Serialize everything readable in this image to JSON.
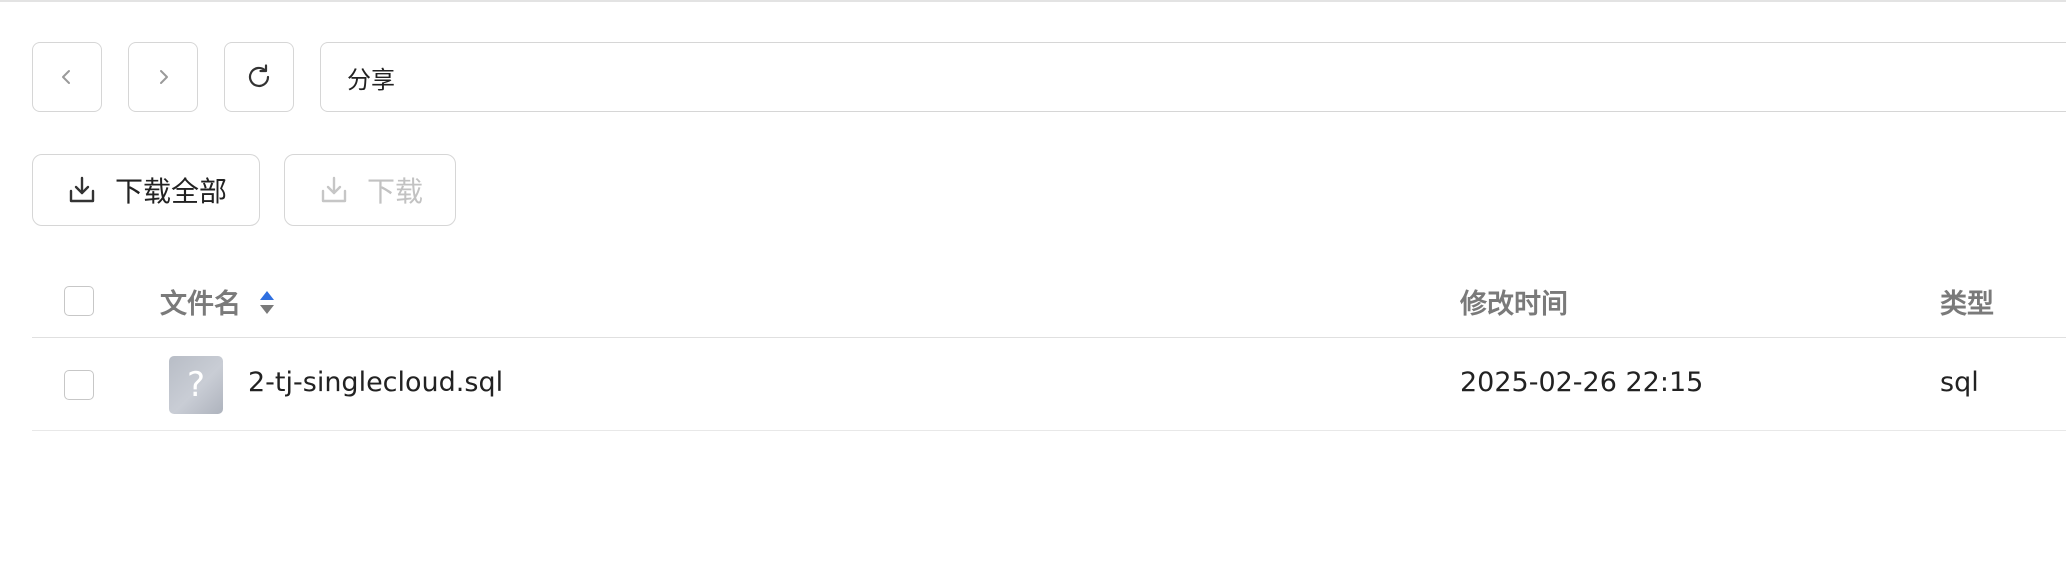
{
  "toolbar": {
    "back_icon": "chevron-left-icon",
    "forward_icon": "chevron-right-icon",
    "refresh_icon": "refresh-icon",
    "path": "分享"
  },
  "actions": {
    "download_all_label": "下载全部",
    "download_label": "下载",
    "download_icon": "download-icon"
  },
  "table": {
    "columns": {
      "name": "文件名",
      "modified": "修改时间",
      "type": "类型"
    },
    "sort_icon": "sort-icon",
    "rows": [
      {
        "icon": "unknown-file-icon",
        "icon_glyph": "?",
        "name": "2-tj-singlecloud.sql",
        "modified": "2025-02-26 22:15",
        "type": "sql"
      }
    ]
  },
  "colors": {
    "border": "#d6d6d6",
    "header_text": "#7a7a7a",
    "disabled_text": "#c2c2c2",
    "sort_active": "#2f6fe0",
    "sort_inactive": "#7a7a7a"
  }
}
